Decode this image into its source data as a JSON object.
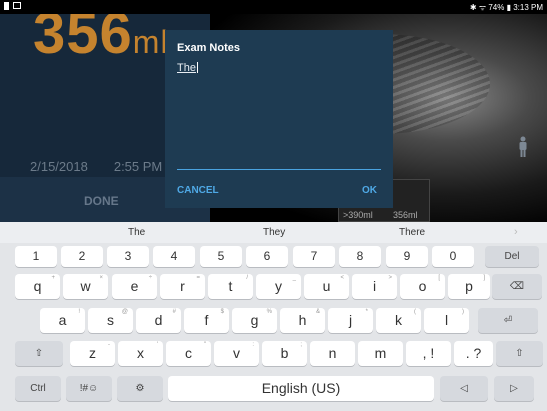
{
  "status": {
    "right_text": "✱ ᯤ 74% ▮ 3:13 PM"
  },
  "app": {
    "volume_value": "356",
    "volume_unit": "ml",
    "date": "2/15/2018",
    "time": "2:55 PM",
    "done_label": "DONE",
    "thumb1_label": ">390ml",
    "thumb2_label": "356ml"
  },
  "dialog": {
    "title": "Exam Notes",
    "text": "The",
    "cancel_label": "CANCEL",
    "ok_label": "OK"
  },
  "keyboard": {
    "suggestions": [
      "The",
      "They",
      "There"
    ],
    "more": "›",
    "number_row": [
      {
        "l": "1"
      },
      {
        "l": "2"
      },
      {
        "l": "3"
      },
      {
        "l": "4"
      },
      {
        "l": "5"
      },
      {
        "l": "6"
      },
      {
        "l": "7"
      },
      {
        "l": "8"
      },
      {
        "l": "9"
      },
      {
        "l": "0"
      },
      {
        "l": "Del"
      }
    ],
    "row1": [
      {
        "l": "q",
        "s": "+"
      },
      {
        "l": "w",
        "s": "×"
      },
      {
        "l": "e",
        "s": "÷"
      },
      {
        "l": "r",
        "s": "="
      },
      {
        "l": "t",
        "s": "/"
      },
      {
        "l": "y",
        "s": "_"
      },
      {
        "l": "u",
        "s": "<"
      },
      {
        "l": "i",
        "s": ">"
      },
      {
        "l": "o",
        "s": "["
      },
      {
        "l": "p",
        "s": "]"
      },
      {
        "l": "⌫",
        "s": ""
      }
    ],
    "row2": [
      {
        "l": "a",
        "s": "!"
      },
      {
        "l": "s",
        "s": "@"
      },
      {
        "l": "d",
        "s": "#"
      },
      {
        "l": "f",
        "s": "$"
      },
      {
        "l": "g",
        "s": "%"
      },
      {
        "l": "h",
        "s": "&"
      },
      {
        "l": "j",
        "s": "*"
      },
      {
        "l": "k",
        "s": "("
      },
      {
        "l": "l",
        "s": ")"
      },
      {
        "l": "⏎",
        "s": ""
      }
    ],
    "row3": [
      {
        "l": "⇧",
        "s": ""
      },
      {
        "l": "z",
        "s": "-"
      },
      {
        "l": "x",
        "s": "'"
      },
      {
        "l": "c",
        "s": "\""
      },
      {
        "l": "v",
        "s": ":"
      },
      {
        "l": "b",
        "s": ";"
      },
      {
        "l": "n",
        "s": ""
      },
      {
        "l": "m",
        "s": ""
      },
      {
        "l": ", !",
        "s": ""
      },
      {
        "l": ". ?",
        "s": ""
      },
      {
        "l": "⇧",
        "s": ""
      }
    ],
    "bottom_row": [
      {
        "l": "Ctrl"
      },
      {
        "l": "!#☺"
      },
      {
        "l": "⚙"
      },
      {
        "l": "English (US)"
      },
      {
        "l": "◁"
      },
      {
        "l": "▷"
      }
    ]
  }
}
